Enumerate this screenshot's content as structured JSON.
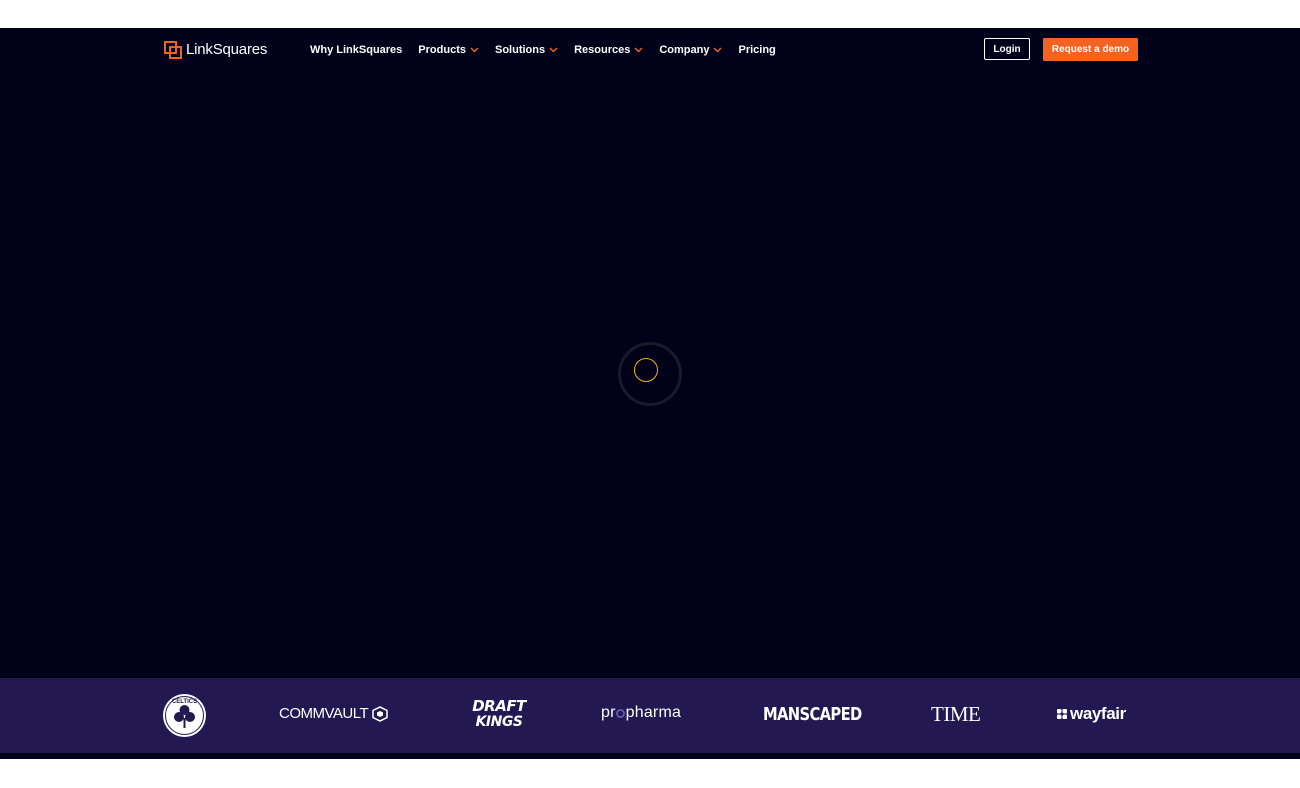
{
  "brand": {
    "name": "LinkSquares",
    "accent_color": "#f26322",
    "background_color": "#02011a",
    "logo_strip_color": "#231852",
    "spinner_color": "#f5b400"
  },
  "nav": {
    "items": [
      {
        "label": "Why LinkSquares",
        "has_dropdown": false
      },
      {
        "label": "Products",
        "has_dropdown": true
      },
      {
        "label": "Solutions",
        "has_dropdown": true
      },
      {
        "label": "Resources",
        "has_dropdown": true
      },
      {
        "label": "Company",
        "has_dropdown": true
      },
      {
        "label": "Pricing",
        "has_dropdown": false
      }
    ],
    "login_label": "Login",
    "demo_label": "Request a demo"
  },
  "loading": {
    "icon": "loading-spinner-icon"
  },
  "customer_logos": {
    "celtics": "CELTICS",
    "commvault": "COMMVAULT",
    "draftkings_line1": "DRAFT",
    "draftkings_line2": "KINGS",
    "propharma_a": "pr",
    "propharma_b": "pharma",
    "manscaped": "MANSCAPED",
    "time": "TIME",
    "wayfair": "wayfair"
  }
}
